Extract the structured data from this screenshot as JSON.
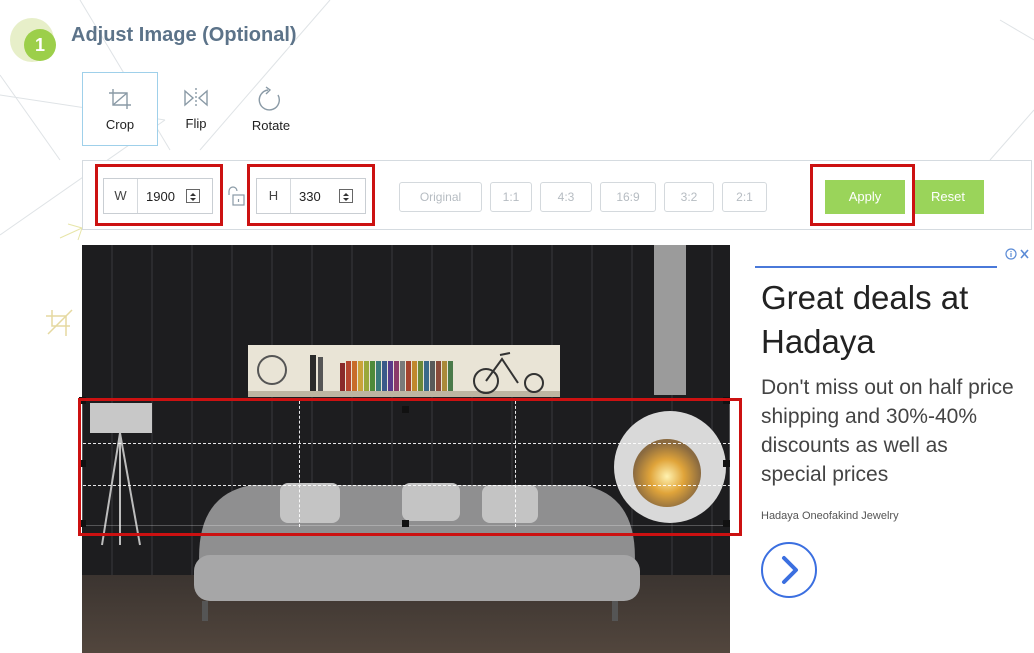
{
  "header": {
    "step_number": "1",
    "title": "Adjust Image (Optional)"
  },
  "tools": [
    {
      "label": "Crop",
      "icon": "crop-icon",
      "active": true
    },
    {
      "label": "Flip",
      "icon": "flip-icon",
      "active": false
    },
    {
      "label": "Rotate",
      "icon": "rotate-icon",
      "active": false
    }
  ],
  "dimensions": {
    "width_label": "W",
    "width_value": "1900",
    "height_label": "H",
    "height_value": "330",
    "lock_icon": "lock-open-icon"
  },
  "aspect_ratios": [
    "Original",
    "1:1",
    "4:3",
    "16:9",
    "3:2",
    "2:1"
  ],
  "actions": {
    "apply": "Apply",
    "reset": "Reset"
  },
  "ad": {
    "headline": "Great deals at Hadaya",
    "body": "Don't miss out on half price shipping and 30%-40% discounts as well as special prices",
    "source": "Hadaya Oneofakind Jewelry",
    "choices_icon": "ad-choices-icon",
    "cta_icon": "chevron-right-icon"
  },
  "colors": {
    "accent_green": "#9ad45a",
    "badge_green": "#9ccf4a",
    "title_blue_gray": "#5c7389",
    "highlight_red": "#cc1111",
    "ad_blue": "#3b6fe0"
  }
}
